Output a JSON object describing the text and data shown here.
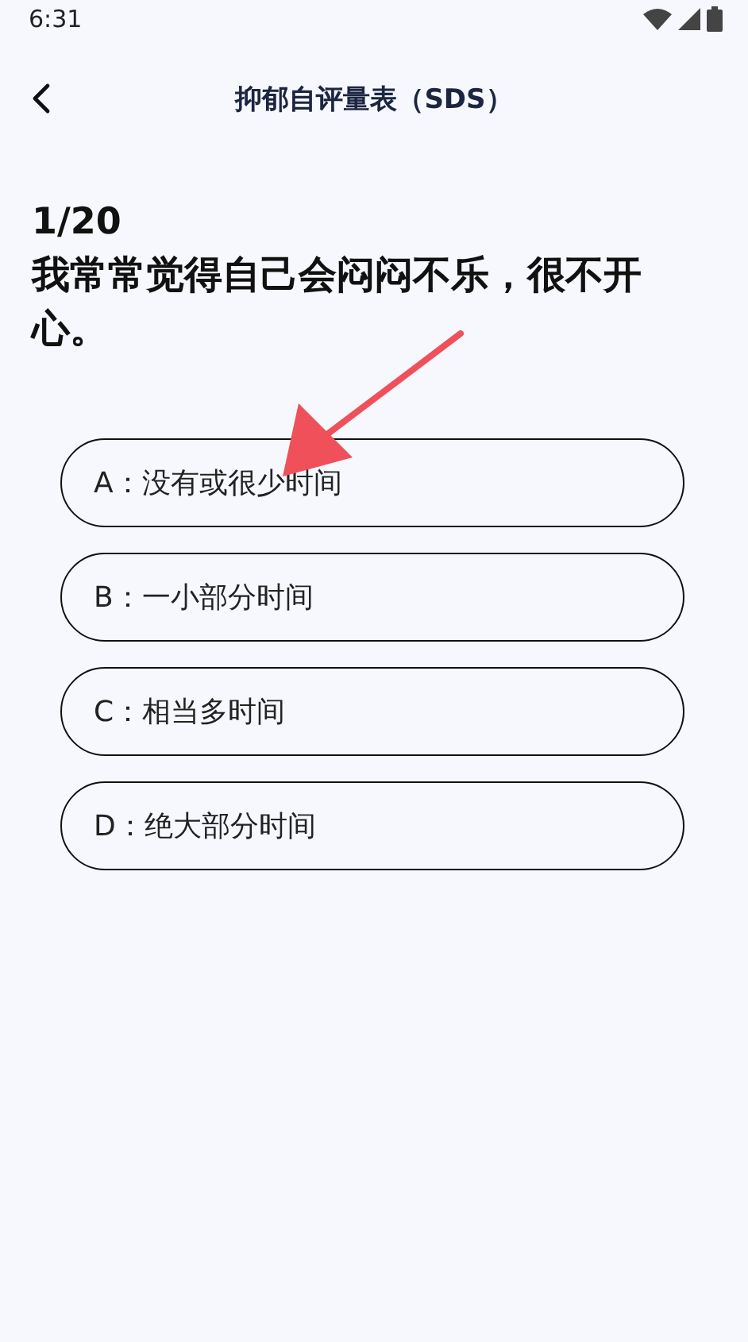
{
  "status_bar": {
    "time": "6:31"
  },
  "header": {
    "title": "抑郁自评量表（SDS）"
  },
  "question": {
    "progress": "1/20",
    "text": "我常常觉得自己会闷闷不乐，很不开心。"
  },
  "options": [
    {
      "label": "A：没有或很少时间",
      "selected": false
    },
    {
      "label": "B：一小部分时间",
      "selected": false
    },
    {
      "label": "C：相当多时间",
      "selected": false
    },
    {
      "label": "D：绝大部分时间",
      "selected": false
    }
  ],
  "annotation": {
    "kind": "arrow"
  }
}
